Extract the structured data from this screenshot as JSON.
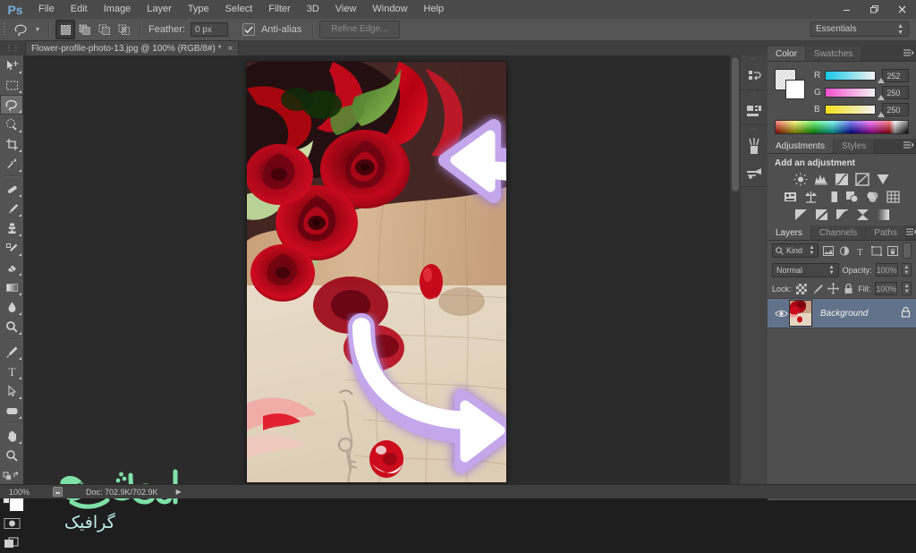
{
  "app": {
    "name": "Adobe Photoshop",
    "logo_text": "Ps"
  },
  "menubar": {
    "items": [
      "File",
      "Edit",
      "Image",
      "Layer",
      "Type",
      "Select",
      "Filter",
      "3D",
      "View",
      "Window",
      "Help"
    ],
    "window_controls": {
      "minimize": "—",
      "restore": "❐",
      "close": "✕"
    }
  },
  "options_bar": {
    "tool_icon": "lasso-icon",
    "selection_modes": [
      "new-selection",
      "add-to-selection",
      "subtract-from-selection",
      "intersect-with-selection"
    ],
    "active_selection_mode": "new-selection",
    "feather_label": "Feather:",
    "feather_value": "0 px",
    "antialias_label": "Anti-alias",
    "antialias_checked": true,
    "refine_edge_label": "Refine Edge...",
    "refine_edge_enabled": false,
    "workspace": "Essentials"
  },
  "tabbar": {
    "document_title": "Flower-profile-photo-13.jpg @ 100% (RGB/8#) *",
    "close_glyph": "×"
  },
  "toolbar": {
    "tools": [
      {
        "name": "move-tool",
        "active": false
      },
      {
        "name": "rectangular-marquee-tool",
        "active": false
      },
      {
        "name": "lasso-tool",
        "active": true
      },
      {
        "name": "quick-selection-tool",
        "active": false
      },
      {
        "name": "crop-tool",
        "active": false
      },
      {
        "name": "eyedropper-tool",
        "active": false
      },
      {
        "name": "spot-healing-brush-tool",
        "active": false
      },
      {
        "name": "brush-tool",
        "active": false
      },
      {
        "name": "clone-stamp-tool",
        "active": false
      },
      {
        "name": "history-brush-tool",
        "active": false
      },
      {
        "name": "eraser-tool",
        "active": false
      },
      {
        "name": "gradient-tool",
        "active": false
      },
      {
        "name": "blur-tool",
        "active": false
      },
      {
        "name": "dodge-tool",
        "active": false
      },
      {
        "name": "pen-tool",
        "active": false
      },
      {
        "name": "horizontal-type-tool",
        "active": false
      },
      {
        "name": "path-selection-tool",
        "active": false
      },
      {
        "name": "rounded-rectangle-tool",
        "active": false
      },
      {
        "name": "hand-tool",
        "active": false
      },
      {
        "name": "zoom-tool",
        "active": false
      }
    ],
    "foreground_color": "#ffffff",
    "background_color": "#ffffff"
  },
  "dock_rail": {
    "icons": [
      "history-icon",
      "properties-icon",
      "brush-icon",
      "brush-presets-icon"
    ]
  },
  "color_panel": {
    "tabs": [
      {
        "label": "Color",
        "active": true
      },
      {
        "label": "Swatches",
        "active": false
      }
    ],
    "channels": [
      {
        "label": "R",
        "value": "252"
      },
      {
        "label": "G",
        "value": "250"
      },
      {
        "label": "B",
        "value": "250"
      }
    ]
  },
  "adjustments_panel": {
    "tabs": [
      {
        "label": "Adjustments",
        "active": true
      },
      {
        "label": "Styles",
        "active": false
      }
    ],
    "title": "Add an adjustment",
    "rows": [
      [
        "brightness-contrast-icon",
        "levels-icon",
        "curves-icon",
        "exposure-icon",
        "vibrance-icon"
      ],
      [
        "hue-saturation-icon",
        "color-balance-icon",
        "black-white-icon",
        "photo-filter-icon",
        "channel-mixer-icon",
        "color-lookup-icon"
      ],
      [
        "invert-icon",
        "posterize-icon",
        "threshold-icon",
        "gradient-map-icon",
        "selective-color-icon"
      ]
    ]
  },
  "layers_panel": {
    "tabs": [
      {
        "label": "Layers",
        "active": true
      },
      {
        "label": "Channels",
        "active": false
      },
      {
        "label": "Paths",
        "active": false
      }
    ],
    "filter_label": "Kind",
    "blend_mode": "Normal",
    "opacity_label": "Opacity:",
    "opacity_value": "100%",
    "lock_label": "Lock:",
    "fill_label": "Fill:",
    "fill_value": "100%",
    "layers": [
      {
        "name": "Background",
        "visible": true,
        "locked": true,
        "selected": true
      }
    ]
  },
  "status_bar": {
    "zoom": "100%",
    "doc_info": "Doc: 702.9K/702.9K",
    "caret": "▶"
  },
  "canvas": {
    "document_name": "Flower-profile-photo-13.jpg",
    "zoom_percent": "100%",
    "annotation_arrows": [
      {
        "name": "curved-arrow-up-left",
        "direction": "left",
        "glow_color": "#b99ae0",
        "fill_color": "#ffffff"
      },
      {
        "name": "curved-arrow-down-right",
        "direction": "right",
        "glow_color": "#b99ae0",
        "fill_color": "#ffffff"
      }
    ]
  },
  "watermark": {
    "brand_text": "وحید شر",
    "sub_text": "گرافیک",
    "leaf_color": "#7fe0a8",
    "text_color": "#bfefe4"
  },
  "colors": {
    "chrome": "#535353",
    "panel": "#4f4f4f",
    "canvas_bg": "#2b2b2b",
    "accent_blue": "#7aaed6",
    "layer_selected": "#63728b",
    "arrow_glow": "#b99ae0"
  }
}
